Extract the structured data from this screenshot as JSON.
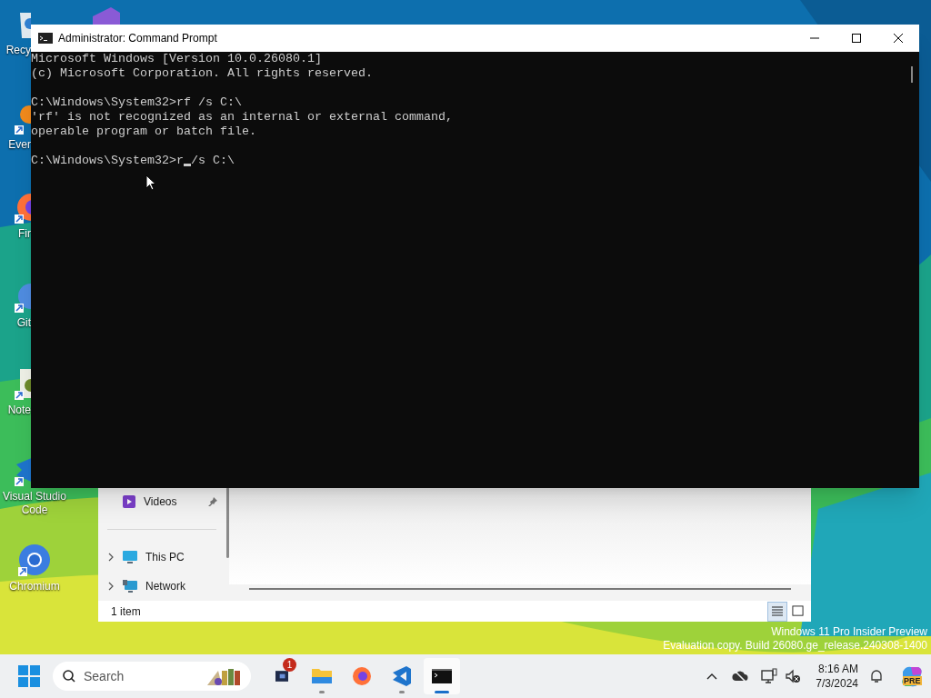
{
  "desktop": {
    "icons": [
      {
        "label": "Recy",
        "kind": "recycle"
      },
      {
        "kind": "studio"
      },
      {
        "label": "Ever",
        "kind": "everything"
      },
      {
        "label": "Fir",
        "kind": "firefox"
      },
      {
        "label": "Git",
        "kind": "git"
      },
      {
        "label": "Note",
        "kind": "notepad"
      },
      {
        "label": "Visual Studio Code",
        "kind": "vscode"
      },
      {
        "label": "Chromium",
        "kind": "chromium"
      }
    ]
  },
  "explorer": {
    "nav": [
      {
        "label": "Videos",
        "kind": "videos",
        "pinned": true,
        "expandable": false
      },
      {
        "label": "This PC",
        "kind": "pc",
        "pinned": false,
        "expandable": true
      },
      {
        "label": "Network",
        "kind": "network",
        "pinned": false,
        "expandable": true
      }
    ],
    "status": "1 item",
    "views": [
      {
        "kind": "details",
        "selected": true
      },
      {
        "kind": "tiles",
        "selected": false
      }
    ]
  },
  "terminal": {
    "title": "Administrator: Command Prompt",
    "blocks": [
      [
        "Microsoft Windows [Version 10.0.26080.1]",
        "(c) Microsoft Corporation. All rights reserved."
      ],
      [
        "C:\\Windows\\System32>rf /s C:\\",
        "'rf' is not recognized as an internal or external command,",
        "operable program or batch file."
      ]
    ],
    "input": {
      "before": "C:\\Windows\\System32>r",
      "after": "/s C:\\"
    }
  },
  "watermark": [
    "Windows 11 Pro Insider Preview",
    "Evaluation copy. Build 26080.ge_release.240308-1400"
  ],
  "taskbar": {
    "search": {
      "placeholder": "Search"
    },
    "apps": [
      {
        "kind": "teams",
        "badge": "1",
        "running": false,
        "active": false
      },
      {
        "kind": "files",
        "running": true,
        "active": false
      },
      {
        "kind": "firefox",
        "running": false,
        "active": false
      },
      {
        "kind": "vscode",
        "running": true,
        "active": false
      },
      {
        "kind": "terminal",
        "running": true,
        "active": true
      }
    ],
    "time": "8:16 AM",
    "date": "7/3/2024",
    "copilot_badge": "PRE"
  }
}
